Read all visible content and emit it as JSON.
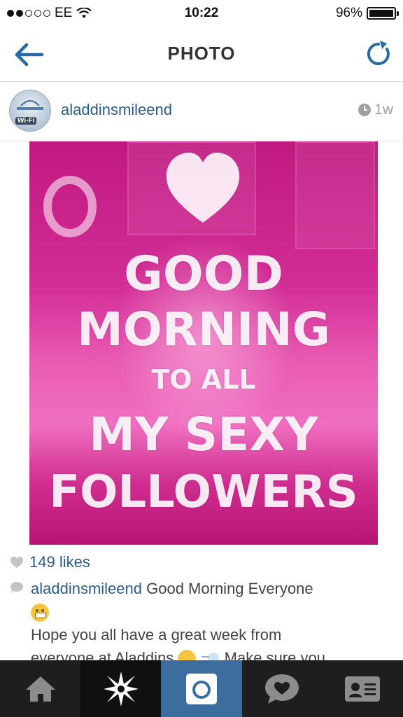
{
  "status_bar": {
    "carrier": "EE",
    "time": "10:22",
    "battery": "96%",
    "signal_bars_filled": 2,
    "signal_bars_total": 5
  },
  "nav": {
    "title": "PHOTO",
    "back_icon": "back-arrow-icon",
    "refresh_icon": "refresh-icon"
  },
  "post": {
    "username": "aladdinsmileend",
    "time_ago": "1w",
    "avatar_badge": "Wi-Fi"
  },
  "photo_text": {
    "line1": "GOOD",
    "line2": "MORNING",
    "line3": "TO ALL",
    "line4": "MY SEXY",
    "line5": "FOLLOWERS"
  },
  "likes": {
    "count_text": "149 likes"
  },
  "caption": {
    "username": "aladdinsmileend",
    "text1": "Good Morning Everyone",
    "text2": "Hope you all have a great week from",
    "text3": "everyone at Aladdins",
    "text4": "Make sure you"
  },
  "tab_bar": {
    "tabs": [
      "home-icon",
      "explore-icon",
      "camera-icon",
      "activity-icon",
      "profile-icon"
    ],
    "active_tab": "camera-icon"
  },
  "colors": {
    "link_blue": "#2a5d8c",
    "tab_active": "#3b6e9f",
    "tab_background": "#1e1e1e"
  }
}
